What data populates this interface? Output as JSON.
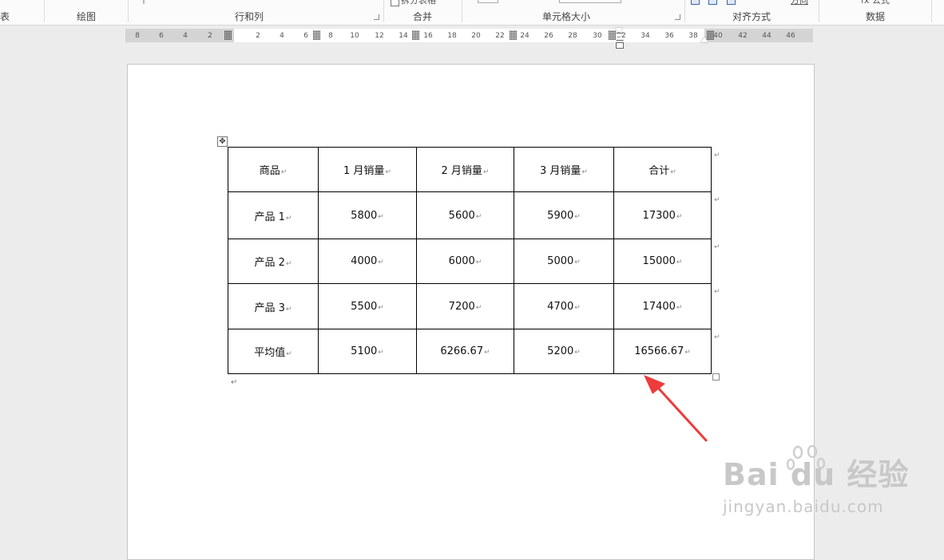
{
  "ribbon": {
    "groups": [
      {
        "label": "表"
      },
      {
        "label": "绘图"
      },
      {
        "label": "行和列"
      },
      {
        "label": "合并"
      },
      {
        "label": "单元格大小"
      },
      {
        "label": "对齐方式"
      },
      {
        "label": "数据"
      }
    ],
    "partial_buttons": {
      "split_table": "拆分表格",
      "text_direction": "方向",
      "formula": "fx 公式"
    }
  },
  "ruler": {
    "labels": [
      "8",
      "6",
      "4",
      "2",
      "2",
      "4",
      "6",
      "8",
      "10",
      "12",
      "14",
      "16",
      "18",
      "20",
      "22",
      "24",
      "26",
      "28",
      "30",
      "32",
      "34",
      "36",
      "38",
      "40",
      "42",
      "44",
      "46"
    ]
  },
  "table": {
    "headers": [
      "商品",
      "1 月销量",
      "2 月销量",
      "3 月销量",
      "合计"
    ],
    "rows": [
      [
        "产品 1",
        "5800",
        "5600",
        "5900",
        "17300"
      ],
      [
        "产品 2",
        "4000",
        "6000",
        "5000",
        "15000"
      ],
      [
        "产品 3",
        "5500",
        "7200",
        "4700",
        "17400"
      ],
      [
        "平均值",
        "5100",
        "6266.67",
        "5200",
        "16566.67"
      ]
    ]
  },
  "marks": {
    "cell_end": "↵",
    "paragraph": "↵",
    "move_handle": "✥"
  },
  "annotation": {
    "arrow_color": "#ee3b3b"
  },
  "watermark": {
    "main": "Bai du 经验",
    "sub": "jingyan.baidu.com"
  }
}
